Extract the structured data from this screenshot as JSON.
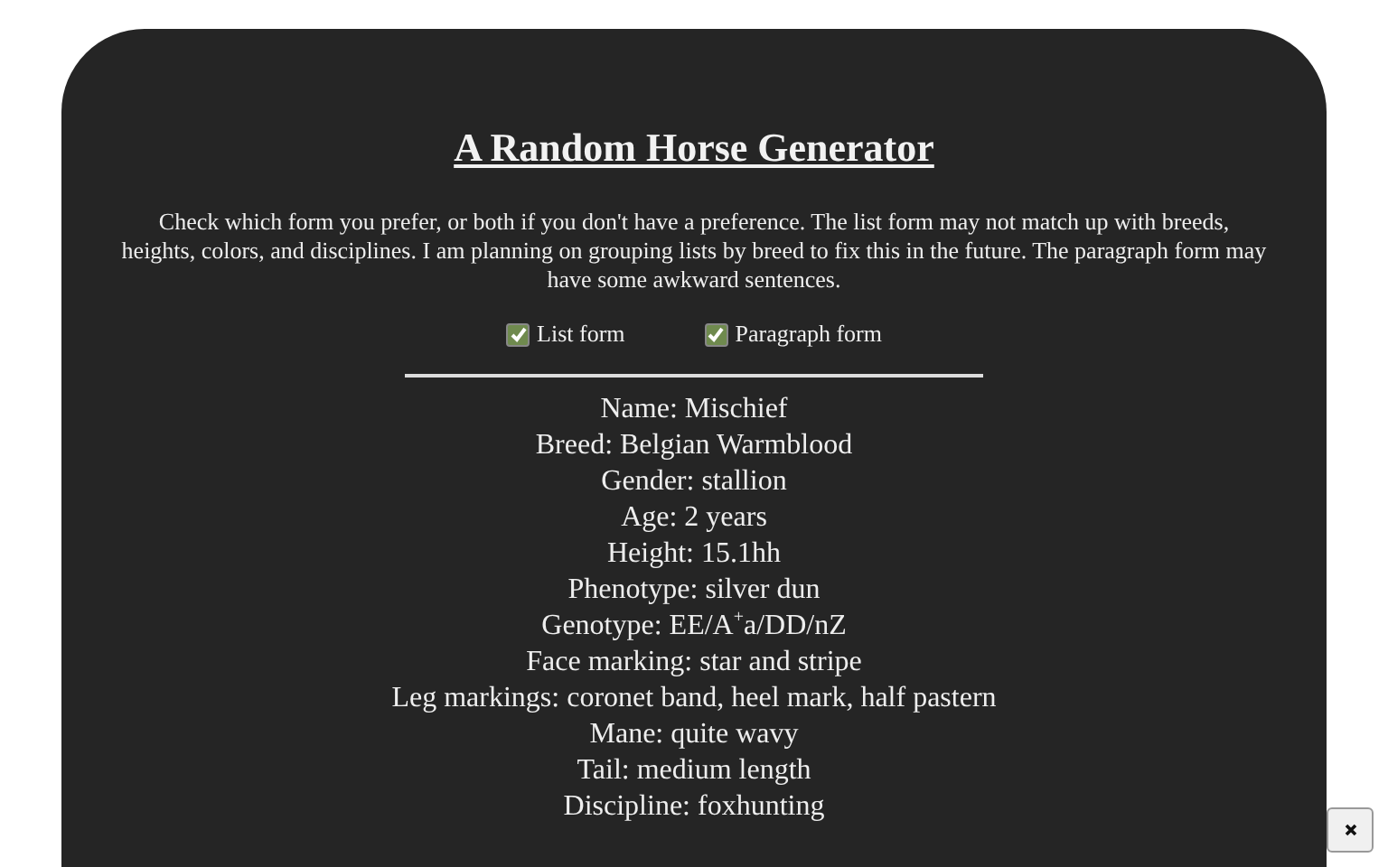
{
  "title": "A Random Horse Generator",
  "intro": "Check which form you prefer, or both if you don't have a preference. The list form may not match up with breeds, heights, colors, and disciplines. I am planning on grouping lists by breed to fix this in the future. The paragraph form may have some awkward sentences.",
  "options": [
    {
      "label": "List form",
      "checked": true
    },
    {
      "label": "Paragraph form",
      "checked": true
    }
  ],
  "traits": [
    "Name: Mischief",
    "Breed: Belgian Warmblood",
    "Gender: stallion",
    "Age: 2 years",
    "Height: 15.1hh",
    "Phenotype: silver dun",
    "Genotype: EE/A$^{+}$a/DD/nZ",
    "Face marking: star and stripe",
    "Leg markings: coronet band, heel mark, half pastern",
    "Mane: quite wavy",
    "Tail: medium length",
    "Discipline: foxhunting"
  ]
}
